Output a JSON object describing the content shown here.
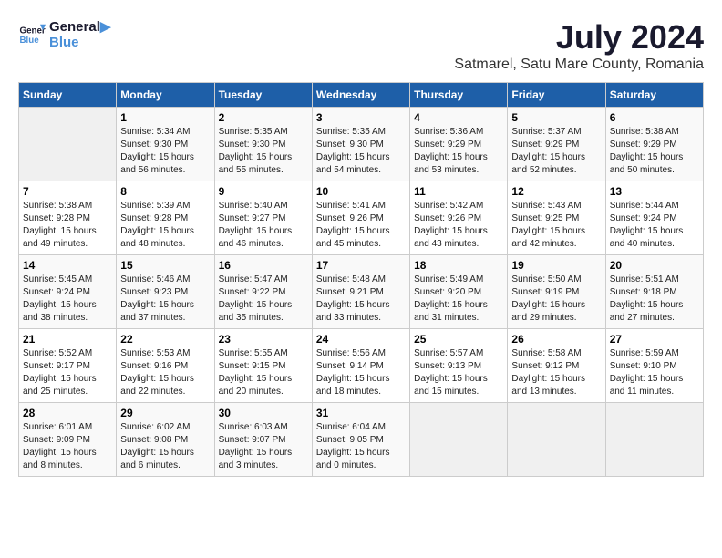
{
  "header": {
    "logo_line1": "General",
    "logo_line2": "Blue",
    "month_year": "July 2024",
    "location": "Satmarel, Satu Mare County, Romania"
  },
  "weekdays": [
    "Sunday",
    "Monday",
    "Tuesday",
    "Wednesday",
    "Thursday",
    "Friday",
    "Saturday"
  ],
  "weeks": [
    [
      {
        "day": "",
        "info": ""
      },
      {
        "day": "1",
        "info": "Sunrise: 5:34 AM\nSunset: 9:30 PM\nDaylight: 15 hours\nand 56 minutes."
      },
      {
        "day": "2",
        "info": "Sunrise: 5:35 AM\nSunset: 9:30 PM\nDaylight: 15 hours\nand 55 minutes."
      },
      {
        "day": "3",
        "info": "Sunrise: 5:35 AM\nSunset: 9:30 PM\nDaylight: 15 hours\nand 54 minutes."
      },
      {
        "day": "4",
        "info": "Sunrise: 5:36 AM\nSunset: 9:29 PM\nDaylight: 15 hours\nand 53 minutes."
      },
      {
        "day": "5",
        "info": "Sunrise: 5:37 AM\nSunset: 9:29 PM\nDaylight: 15 hours\nand 52 minutes."
      },
      {
        "day": "6",
        "info": "Sunrise: 5:38 AM\nSunset: 9:29 PM\nDaylight: 15 hours\nand 50 minutes."
      }
    ],
    [
      {
        "day": "7",
        "info": "Sunrise: 5:38 AM\nSunset: 9:28 PM\nDaylight: 15 hours\nand 49 minutes."
      },
      {
        "day": "8",
        "info": "Sunrise: 5:39 AM\nSunset: 9:28 PM\nDaylight: 15 hours\nand 48 minutes."
      },
      {
        "day": "9",
        "info": "Sunrise: 5:40 AM\nSunset: 9:27 PM\nDaylight: 15 hours\nand 46 minutes."
      },
      {
        "day": "10",
        "info": "Sunrise: 5:41 AM\nSunset: 9:26 PM\nDaylight: 15 hours\nand 45 minutes."
      },
      {
        "day": "11",
        "info": "Sunrise: 5:42 AM\nSunset: 9:26 PM\nDaylight: 15 hours\nand 43 minutes."
      },
      {
        "day": "12",
        "info": "Sunrise: 5:43 AM\nSunset: 9:25 PM\nDaylight: 15 hours\nand 42 minutes."
      },
      {
        "day": "13",
        "info": "Sunrise: 5:44 AM\nSunset: 9:24 PM\nDaylight: 15 hours\nand 40 minutes."
      }
    ],
    [
      {
        "day": "14",
        "info": "Sunrise: 5:45 AM\nSunset: 9:24 PM\nDaylight: 15 hours\nand 38 minutes."
      },
      {
        "day": "15",
        "info": "Sunrise: 5:46 AM\nSunset: 9:23 PM\nDaylight: 15 hours\nand 37 minutes."
      },
      {
        "day": "16",
        "info": "Sunrise: 5:47 AM\nSunset: 9:22 PM\nDaylight: 15 hours\nand 35 minutes."
      },
      {
        "day": "17",
        "info": "Sunrise: 5:48 AM\nSunset: 9:21 PM\nDaylight: 15 hours\nand 33 minutes."
      },
      {
        "day": "18",
        "info": "Sunrise: 5:49 AM\nSunset: 9:20 PM\nDaylight: 15 hours\nand 31 minutes."
      },
      {
        "day": "19",
        "info": "Sunrise: 5:50 AM\nSunset: 9:19 PM\nDaylight: 15 hours\nand 29 minutes."
      },
      {
        "day": "20",
        "info": "Sunrise: 5:51 AM\nSunset: 9:18 PM\nDaylight: 15 hours\nand 27 minutes."
      }
    ],
    [
      {
        "day": "21",
        "info": "Sunrise: 5:52 AM\nSunset: 9:17 PM\nDaylight: 15 hours\nand 25 minutes."
      },
      {
        "day": "22",
        "info": "Sunrise: 5:53 AM\nSunset: 9:16 PM\nDaylight: 15 hours\nand 22 minutes."
      },
      {
        "day": "23",
        "info": "Sunrise: 5:55 AM\nSunset: 9:15 PM\nDaylight: 15 hours\nand 20 minutes."
      },
      {
        "day": "24",
        "info": "Sunrise: 5:56 AM\nSunset: 9:14 PM\nDaylight: 15 hours\nand 18 minutes."
      },
      {
        "day": "25",
        "info": "Sunrise: 5:57 AM\nSunset: 9:13 PM\nDaylight: 15 hours\nand 15 minutes."
      },
      {
        "day": "26",
        "info": "Sunrise: 5:58 AM\nSunset: 9:12 PM\nDaylight: 15 hours\nand 13 minutes."
      },
      {
        "day": "27",
        "info": "Sunrise: 5:59 AM\nSunset: 9:10 PM\nDaylight: 15 hours\nand 11 minutes."
      }
    ],
    [
      {
        "day": "28",
        "info": "Sunrise: 6:01 AM\nSunset: 9:09 PM\nDaylight: 15 hours\nand 8 minutes."
      },
      {
        "day": "29",
        "info": "Sunrise: 6:02 AM\nSunset: 9:08 PM\nDaylight: 15 hours\nand 6 minutes."
      },
      {
        "day": "30",
        "info": "Sunrise: 6:03 AM\nSunset: 9:07 PM\nDaylight: 15 hours\nand 3 minutes."
      },
      {
        "day": "31",
        "info": "Sunrise: 6:04 AM\nSunset: 9:05 PM\nDaylight: 15 hours\nand 0 minutes."
      },
      {
        "day": "",
        "info": ""
      },
      {
        "day": "",
        "info": ""
      },
      {
        "day": "",
        "info": ""
      }
    ]
  ]
}
